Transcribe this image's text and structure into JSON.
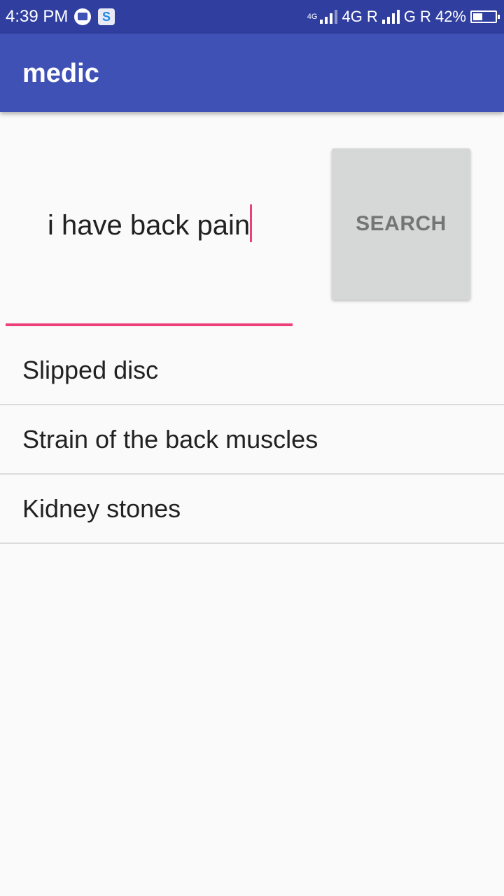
{
  "status_bar": {
    "time": "4:39 PM",
    "network_small": "4G",
    "network1": "4G R",
    "network2": "G R",
    "battery": "42%",
    "battery_level": 0.42
  },
  "app_bar": {
    "title": "medic"
  },
  "search": {
    "query": "i have back pain",
    "button_label": "SEARCH"
  },
  "results": [
    {
      "label": "Slipped disc"
    },
    {
      "label": "Strain of the back muscles"
    },
    {
      "label": "Kidney stones"
    }
  ],
  "colors": {
    "primary": "#3f51b5",
    "primary_dark": "#303f9f",
    "accent": "#ec407a"
  }
}
